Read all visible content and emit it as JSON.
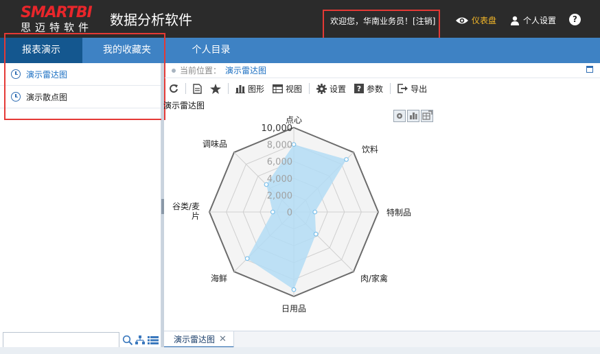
{
  "header": {
    "logo_main": "SMARTBI",
    "logo_sub": "思迈特软件",
    "app_title": "数据分析软件",
    "welcome_text": "欢迎您，华南业务员！[",
    "logout_label": "注销",
    "welcome_suffix": "]",
    "dashboard_label": "仪表盘",
    "settings_label": "个人设置",
    "help_label": "?"
  },
  "nav": {
    "tabs": [
      {
        "label": "报表演示",
        "active": true
      },
      {
        "label": "我的收藏夹",
        "active": false
      },
      {
        "label": "个人目录",
        "active": false
      }
    ]
  },
  "sidebar": {
    "items": [
      {
        "label": "演示雷达图",
        "active": true
      },
      {
        "label": "演示散点图",
        "active": false
      }
    ],
    "search_placeholder": ""
  },
  "breadcrumb": {
    "prefix": "当前位置：",
    "current": "演示雷达图"
  },
  "toolbar": {
    "chart_label": "图形",
    "view_label": "视图",
    "settings_label": "设置",
    "params_label": "参数",
    "export_label": "导出"
  },
  "report": {
    "title": "演示雷达图"
  },
  "chart_data": {
    "type": "radar",
    "axes": [
      "点心",
      "饮料",
      "特制品",
      "肉/家禽",
      "日用品",
      "海鲜",
      "谷类/麦片",
      "调味品"
    ],
    "values": [
      8000,
      8800,
      2500,
      3700,
      9200,
      7800,
      2500,
      4600
    ],
    "rmax": 10000,
    "ticks": [
      0,
      2000,
      4000,
      6000,
      8000,
      10000
    ],
    "tick_labels": [
      "0",
      "2,000",
      "4,000",
      "6,000",
      "8,000",
      "10,000"
    ],
    "fill_color": "#b3dcf5",
    "point_color": "#7cc1ec",
    "grid_color": "#cfcfcf",
    "outer_color": "#6b6b6b"
  },
  "bottom_tabs": [
    {
      "label": "演示雷达图",
      "close": "✕"
    }
  ]
}
